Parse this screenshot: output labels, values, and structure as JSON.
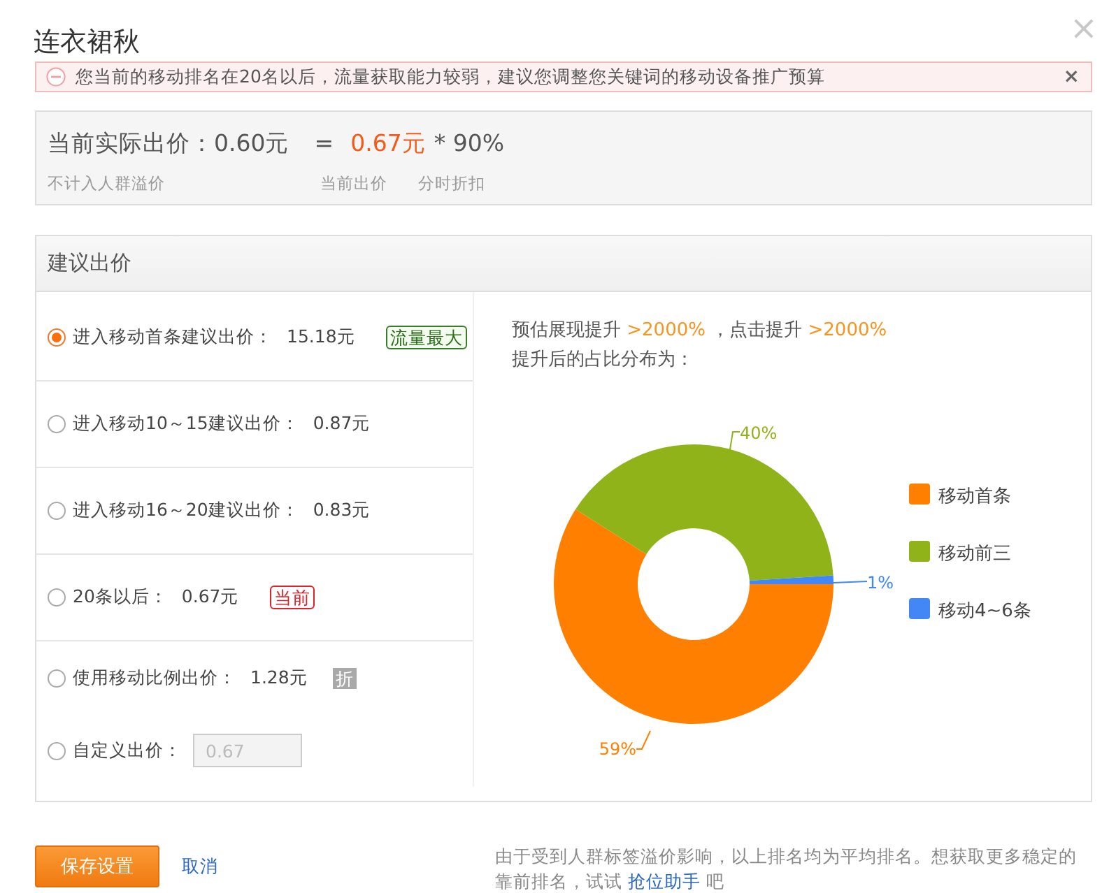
{
  "dialog": {
    "title": "连衣裙秋",
    "close_icon": "×"
  },
  "alert": {
    "text": "您当前的移动排名在20名以后，流量获取能力较弱，建议您调整您关键词的移动设备推广预算",
    "close_icon": "×"
  },
  "current_price": {
    "label": "当前实际出价：0.60元",
    "equals": "=",
    "price": "0.67元",
    "factor": "* 90%",
    "notes": [
      "不计入人群溢价",
      "当前出价",
      "分时折扣"
    ]
  },
  "suggest": {
    "title": "建议出价",
    "options": [
      {
        "kind": "price",
        "label": "进入移动首条建议出价：",
        "value": "15.18元",
        "selected": true,
        "badge": {
          "kind": "flow",
          "text": "流量最大"
        }
      },
      {
        "kind": "price",
        "label": "进入移动10～15建议出价：",
        "value": "0.87元",
        "selected": false
      },
      {
        "kind": "price",
        "label": "进入移动16～20建议出价：",
        "value": "0.83元",
        "selected": false
      },
      {
        "kind": "price",
        "label": "20条以后：",
        "value": "0.67元",
        "selected": false,
        "badge": {
          "kind": "current",
          "text": "当前"
        }
      },
      {
        "kind": "price",
        "label": "使用移动比例出价：",
        "value": "1.28元",
        "selected": false,
        "badge": {
          "kind": "discount",
          "text": "折"
        }
      },
      {
        "kind": "input",
        "label": "自定义出价：",
        "value": "0.67",
        "selected": false,
        "disabled": true
      }
    ],
    "estimate": {
      "parts": [
        "预估展现提升",
        ">2000%",
        "，点击提升",
        ">2000%"
      ],
      "subtitle": "提升后的占比分布为："
    },
    "chart_data": {
      "type": "donut",
      "categories": [
        "移动首条",
        "移动前三",
        "移动4~6条"
      ],
      "legend": "right",
      "series": [
        {
          "colors": [
            "#ff8000",
            "#8fb319",
            "#4287f5"
          ],
          "values": [
            59,
            40,
            1
          ]
        }
      ],
      "value_labels": [
        "59%",
        "40%",
        "1%"
      ]
    }
  },
  "footer": {
    "save": "保存设置",
    "cancel": "取消",
    "note": "由于受到人群标签溢价影响，以上排名均为平均排名。想获取更多稳定的靠前排名，试试 ",
    "link": "抢位助手",
    "note_end": " 吧"
  }
}
